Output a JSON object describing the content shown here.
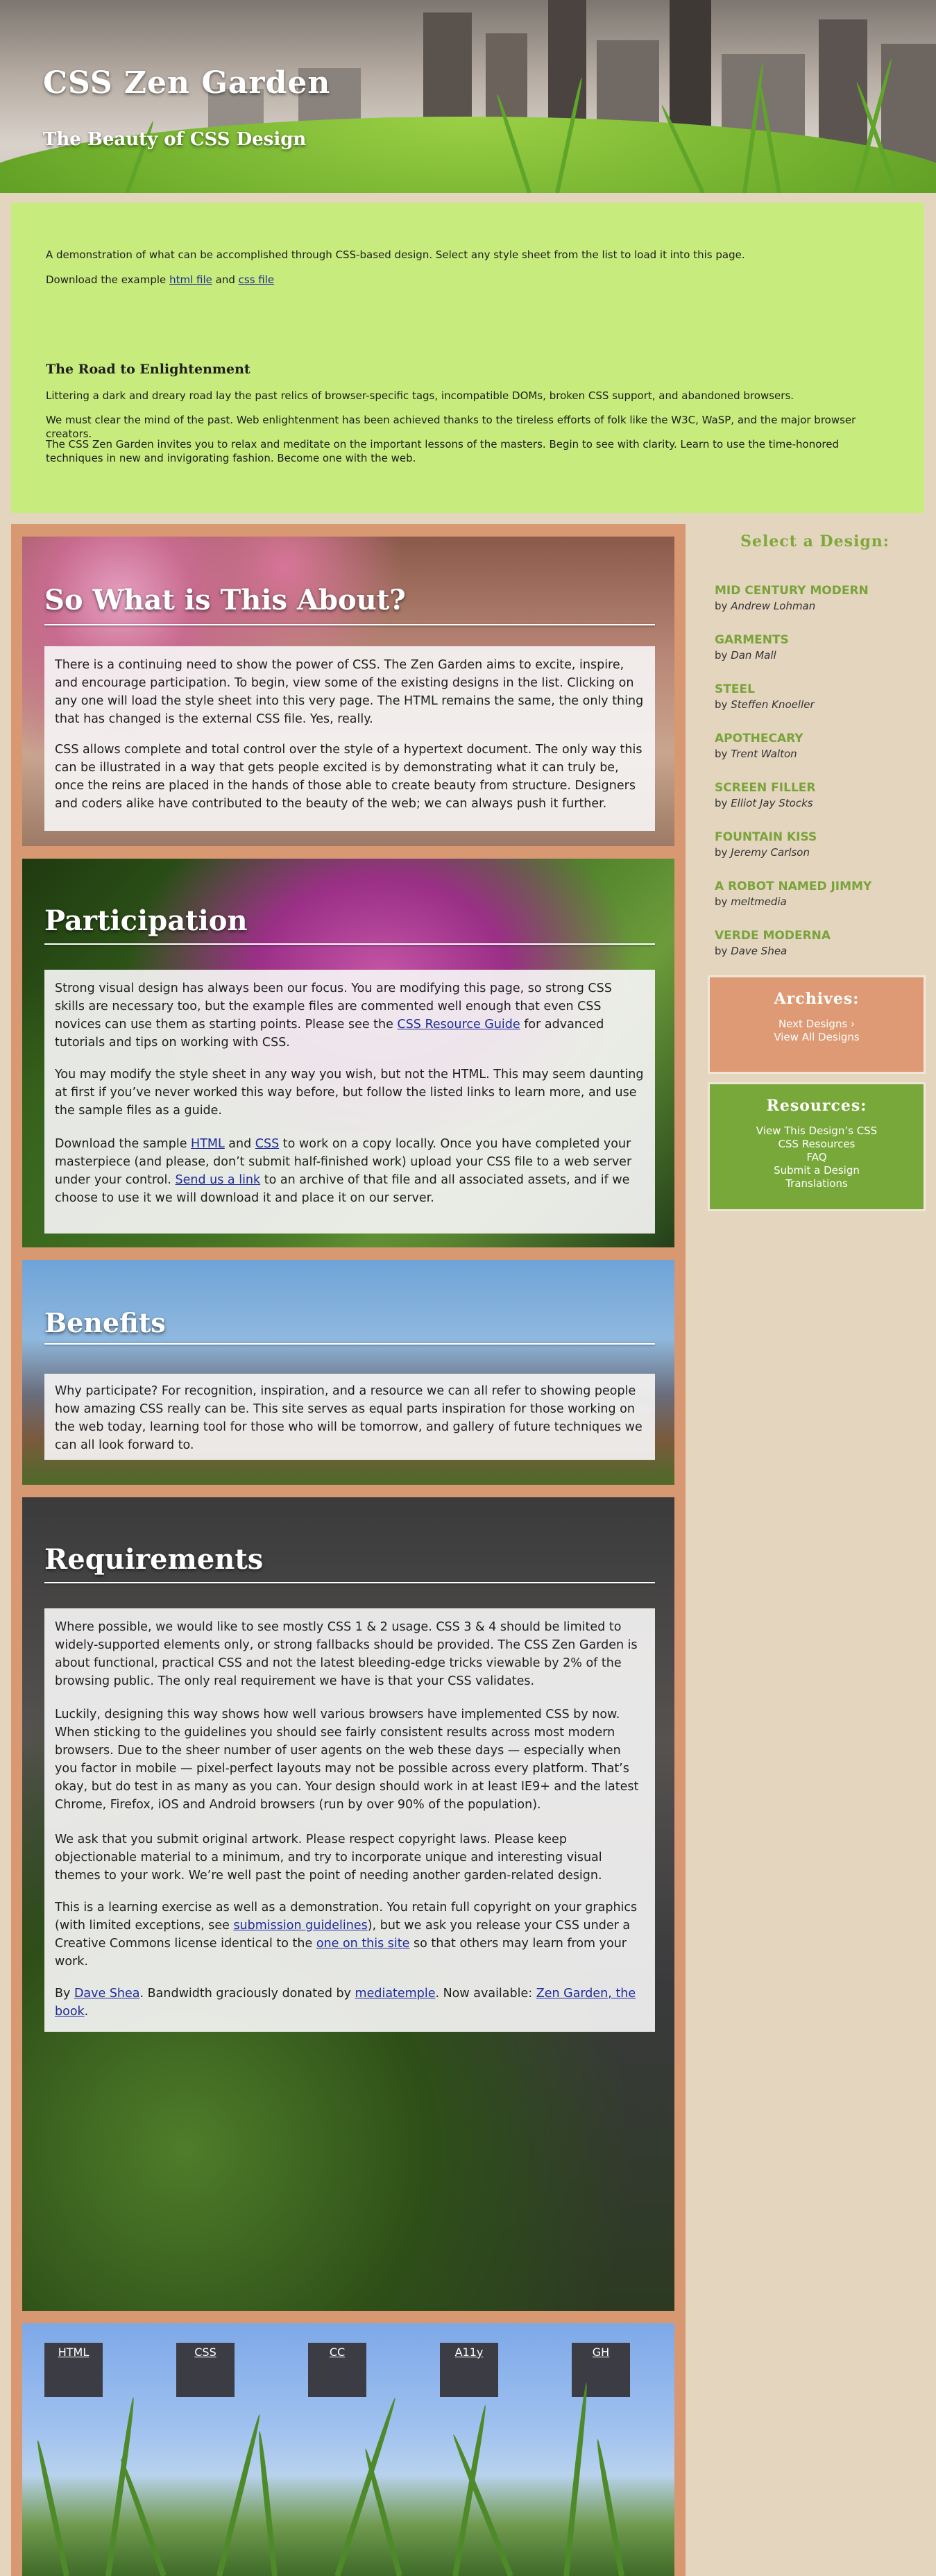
{
  "header": {
    "title": "CSS Zen Garden",
    "subtitle": "The Beauty of CSS Design"
  },
  "intro": {
    "summary": "A demonstration of what can be accomplished through CSS-based design. Select any style sheet from the list to load it into this page.",
    "download_prefix": "Download the example",
    "html_file": "html file",
    "and": "and",
    "css_file": "css file",
    "preamble_title": "The Road to Enlightenment",
    "preamble_p1": "Littering a dark and dreary road lay the past relics of browser-specific tags, incompatible DOMs, broken CSS support, and abandoned browsers.",
    "preamble_p2": "We must clear the mind of the past. Web enlightenment has been achieved thanks to the tireless efforts of folk like the W3C, WaSP, and the major browser creators.",
    "preamble_p3": "The CSS Zen Garden invites you to relax and meditate on the important lessons of the masters. Begin to see with clarity. Learn to use the time-honored techniques in new and invigorating fashion. Become one with the web."
  },
  "explanation": {
    "title": "So What is This About?",
    "p1": "There is a continuing need to show the power of CSS. The Zen Garden aims to excite, inspire, and encourage participation. To begin, view some of the existing designs in the list. Clicking on any one will load the style sheet into this very page. The HTML remains the same, the only thing that has changed is the external CSS file. Yes, really.",
    "p2": "CSS allows complete and total control over the style of a hypertext document. The only way this can be illustrated in a way that gets people excited is by demonstrating what it can truly be, once the reins are placed in the hands of those able to create beauty from structure. Designers and coders alike have contributed to the beauty of the web; we can always push it further."
  },
  "participation": {
    "title": "Participation",
    "p1_a": "Strong visual design has always been our focus. You are modifying this page, so strong CSS skills are necessary too, but the example files are commented well enough that even CSS novices can use them as starting points. Please see the ",
    "p1_link": "CSS Resource Guide",
    "p1_b": " for advanced tutorials and tips on working with CSS.",
    "p2": "You may modify the style sheet in any way you wish, but not the HTML. This may seem daunting at first if you’ve never worked this way before, but follow the listed links to learn more, and use the sample files as a guide.",
    "p3_a": "Download the sample ",
    "p3_html": "HTML",
    "p3_and": " and ",
    "p3_css": "CSS",
    "p3_b": " to work on a copy locally. Once you have completed your masterpiece (and please, don’t submit half-finished work) upload your CSS file to a web server under your control. ",
    "p3_link": "Send us a link",
    "p3_c": " to an archive of that file and all associated assets, and if we choose to use it we will download it and place it on our server."
  },
  "benefits": {
    "title": "Benefits",
    "p1": "Why participate? For recognition, inspiration, and a resource we can all refer to showing people how amazing CSS really can be. This site serves as equal parts inspiration for those working on the web today, learning tool for those who will be tomorrow, and gallery of future techniques we can all look forward to."
  },
  "requirements": {
    "title": "Requirements",
    "p1": "Where possible, we would like to see mostly CSS 1 & 2 usage. CSS 3 & 4 should be limited to widely-supported elements only, or strong fallbacks should be provided. The CSS Zen Garden is about functional, practical CSS and not the latest bleeding-edge tricks viewable by 2% of the browsing public. The only real requirement we have is that your CSS validates.",
    "p2": "Luckily, designing this way shows how well various browsers have implemented CSS by now. When sticking to the guidelines you should see fairly consistent results across most modern browsers. Due to the sheer number of user agents on the web these days — especially when you factor in mobile — pixel-perfect layouts may not be possible across every platform. That’s okay, but do test in as many as you can. Your design should work in at least IE9+ and the latest Chrome, Firefox, iOS and Android browsers (run by over 90% of the population).",
    "p3": "We ask that you submit original artwork. Please respect copyright laws. Please keep objectionable material to a minimum, and try to incorporate unique and interesting visual themes to your work. We’re well past the point of needing another garden-related design.",
    "p4_a": "This is a learning exercise as well as a demonstration. You retain full copyright on your graphics (with limited exceptions, see ",
    "p4_link1": "submission guidelines",
    "p4_b": "), but we ask you release your CSS under a Creative Commons license identical to the ",
    "p4_link2": "one on this site",
    "p4_c": " so that others may learn from your work.",
    "p5_a": "By ",
    "p5_link1": "Dave Shea",
    "p5_b": ". Bandwidth graciously donated by ",
    "p5_link2": "mediatemple",
    "p5_c": ". Now available: ",
    "p5_link3": "Zen Garden, the book",
    "p5_d": "."
  },
  "footer": {
    "links": [
      "HTML",
      "CSS",
      "CC",
      "A11y",
      "GH"
    ]
  },
  "sidebar": {
    "select_title": "Select a Design:",
    "by": "by",
    "designs": [
      {
        "name": "MID CENTURY MODERN",
        "author": "Andrew Lohman"
      },
      {
        "name": "GARMENTS",
        "author": "Dan Mall"
      },
      {
        "name": "STEEL",
        "author": "Steffen Knoeller"
      },
      {
        "name": "APOTHECARY",
        "author": "Trent Walton"
      },
      {
        "name": "SCREEN FILLER",
        "author": "Elliot Jay Stocks"
      },
      {
        "name": "FOUNTAIN KISS",
        "author": "Jeremy Carlson"
      },
      {
        "name": "A ROBOT NAMED JIMMY",
        "author": "meltmedia"
      },
      {
        "name": "VERDE MODERNA",
        "author": "Dave Shea"
      }
    ],
    "archives": {
      "title": "Archives:",
      "next": "Next Designs ›",
      "all": "View All Designs"
    },
    "resources": {
      "title": "Resources:",
      "links": [
        "View This Design’s CSS",
        "CSS Resources",
        "FAQ",
        "Submit a Design",
        "Translations"
      ]
    }
  },
  "colors": {
    "intro_bg": "#c7eb7c",
    "main_frame": "#d79872",
    "sidebar_bg": "#e4d5bf",
    "design_link": "#7aa33a",
    "archives_bg": "#dd9a74",
    "resources_bg": "#79a83a"
  }
}
